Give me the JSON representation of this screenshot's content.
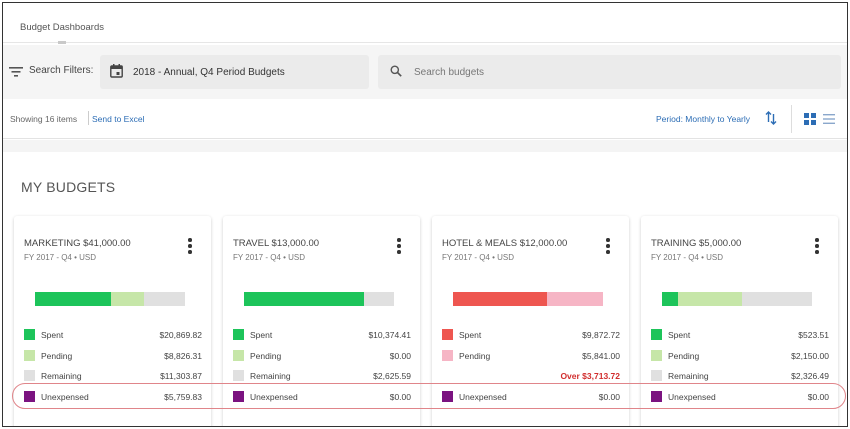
{
  "app": {
    "title": "Budget Dashboards"
  },
  "filters": {
    "label": "Search Filters:",
    "selected_period": "2018 - Annual, Q4 Period Budgets",
    "search_placeholder": "Search budgets"
  },
  "toolbar": {
    "showing": "Showing 16 items",
    "send_to_excel": "Send to Excel",
    "period_label": "Period: Monthly to Yearly"
  },
  "section": {
    "title": "MY BUDGETS"
  },
  "colors": {
    "spent_green": "#1dc45a",
    "pending_lightgreen": "#c6e6a8",
    "remaining_gray": "#e0e0e0",
    "unexpensed_purple": "#7b1380",
    "spent_red": "#ee5650",
    "pending_pink": "#f6b5c5",
    "link_blue": "#2c6db5",
    "over_red": "#d12d2d"
  },
  "cards": [
    {
      "title": "MARKETING $41,000.00",
      "subtitle": "FY 2017 - Q4 • USD",
      "bar": [
        {
          "type": "spent",
          "fraction": 0.509,
          "color": "#1dc45a"
        },
        {
          "type": "pending",
          "fraction": 0.215,
          "color": "#c6e6a8"
        },
        {
          "type": "remaining",
          "fraction": 0.276,
          "color": "#e0e0e0"
        }
      ],
      "legend": [
        {
          "label": "Spent",
          "value": "$20,869.82",
          "color": "#1dc45a",
          "over": false
        },
        {
          "label": "Pending",
          "value": "$8,826.31",
          "color": "#c6e6a8",
          "over": false
        },
        {
          "label": "Remaining",
          "value": "$11,303.87",
          "color": "#e0e0e0",
          "over": false
        },
        {
          "label": "Unexpensed",
          "value": "$5,759.83",
          "color": "#7b1380",
          "over": false
        }
      ]
    },
    {
      "title": "TRAVEL $13,000.00",
      "subtitle": "FY 2017 - Q4 • USD",
      "bar": [
        {
          "type": "spent",
          "fraction": 0.798,
          "color": "#1dc45a"
        },
        {
          "type": "pending",
          "fraction": 0.0,
          "color": "#c6e6a8"
        },
        {
          "type": "remaining",
          "fraction": 0.202,
          "color": "#e0e0e0"
        }
      ],
      "legend": [
        {
          "label": "Spent",
          "value": "$10,374.41",
          "color": "#1dc45a",
          "over": false
        },
        {
          "label": "Pending",
          "value": "$0.00",
          "color": "#c6e6a8",
          "over": false
        },
        {
          "label": "Remaining",
          "value": "$2,625.59",
          "color": "#e0e0e0",
          "over": false
        },
        {
          "label": "Unexpensed",
          "value": "$0.00",
          "color": "#7b1380",
          "over": false
        }
      ]
    },
    {
      "title": "HOTEL & MEALS $12,000.00",
      "subtitle": "FY 2017 - Q4 • USD",
      "bar": [
        {
          "type": "spent",
          "fraction": 0.627,
          "color": "#ee5650"
        },
        {
          "type": "pending",
          "fraction": 0.373,
          "color": "#f6b5c5"
        },
        {
          "type": "remaining",
          "fraction": 0.0,
          "color": "#e0e0e0"
        }
      ],
      "legend": [
        {
          "label": "Spent",
          "value": "$9,872.72",
          "color": "#ee5650",
          "over": false
        },
        {
          "label": "Pending",
          "value": "$5,841.00",
          "color": "#f6b5c5",
          "over": false
        },
        {
          "label": "",
          "value": "Over $3,713.72",
          "color": "",
          "over": true
        },
        {
          "label": "Unexpensed",
          "value": "$0.00",
          "color": "#7b1380",
          "over": false
        }
      ]
    },
    {
      "title": "TRAINING $5,000.00",
      "subtitle": "FY 2017 - Q4 • USD",
      "bar": [
        {
          "type": "spent",
          "fraction": 0.105,
          "color": "#1dc45a"
        },
        {
          "type": "pending",
          "fraction": 0.43,
          "color": "#c6e6a8"
        },
        {
          "type": "remaining",
          "fraction": 0.465,
          "color": "#e0e0e0"
        }
      ],
      "legend": [
        {
          "label": "Spent",
          "value": "$523.51",
          "color": "#1dc45a",
          "over": false
        },
        {
          "label": "Pending",
          "value": "$2,150.00",
          "color": "#c6e6a8",
          "over": false
        },
        {
          "label": "Remaining",
          "value": "$2,326.49",
          "color": "#e0e0e0",
          "over": false
        },
        {
          "label": "Unexpensed",
          "value": "$0.00",
          "color": "#7b1380",
          "over": false
        }
      ]
    }
  ]
}
